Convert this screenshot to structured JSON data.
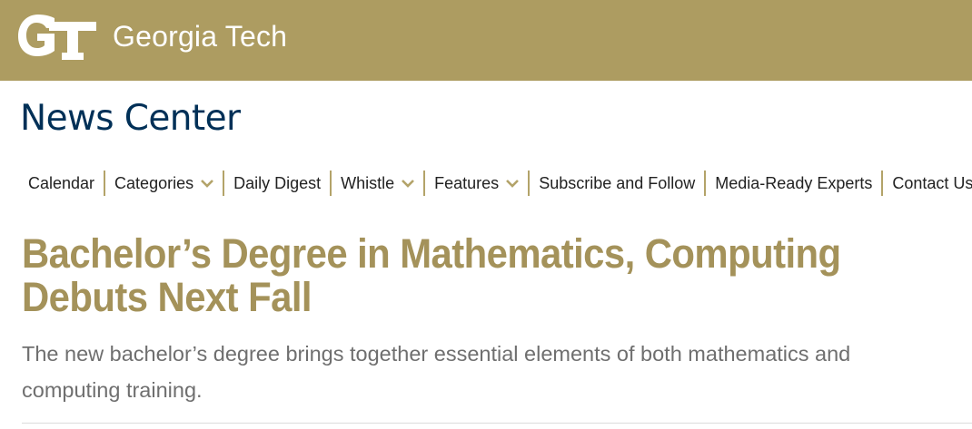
{
  "header": {
    "logo_monogram": "GT",
    "logo_text": "Georgia Tech",
    "background_color": "#AD9C61"
  },
  "site_title": "News Center",
  "nav": {
    "items": [
      {
        "label": "Calendar",
        "has_dropdown": false
      },
      {
        "label": "Categories",
        "has_dropdown": true,
        "icon": "chevron-down-icon"
      },
      {
        "label": "Daily Digest",
        "has_dropdown": false
      },
      {
        "label": "Whistle",
        "has_dropdown": true,
        "icon": "chevron-down-icon"
      },
      {
        "label": "Features",
        "has_dropdown": true,
        "icon": "chevron-down-icon"
      },
      {
        "label": "Subscribe and Follow",
        "has_dropdown": false
      },
      {
        "label": "Media-Ready Experts",
        "has_dropdown": false
      },
      {
        "label": "Contact Us",
        "has_dropdown": false
      }
    ],
    "separator_color": "#B3A369",
    "chevron_color": "#B3A369"
  },
  "article": {
    "headline": "Bachelor’s Degree in Mathematics, Computing Debuts Next Fall",
    "subhead": "The new bachelor’s degree brings together essential elements of both mathematics and computing training.",
    "headline_color": "#A4925A"
  }
}
